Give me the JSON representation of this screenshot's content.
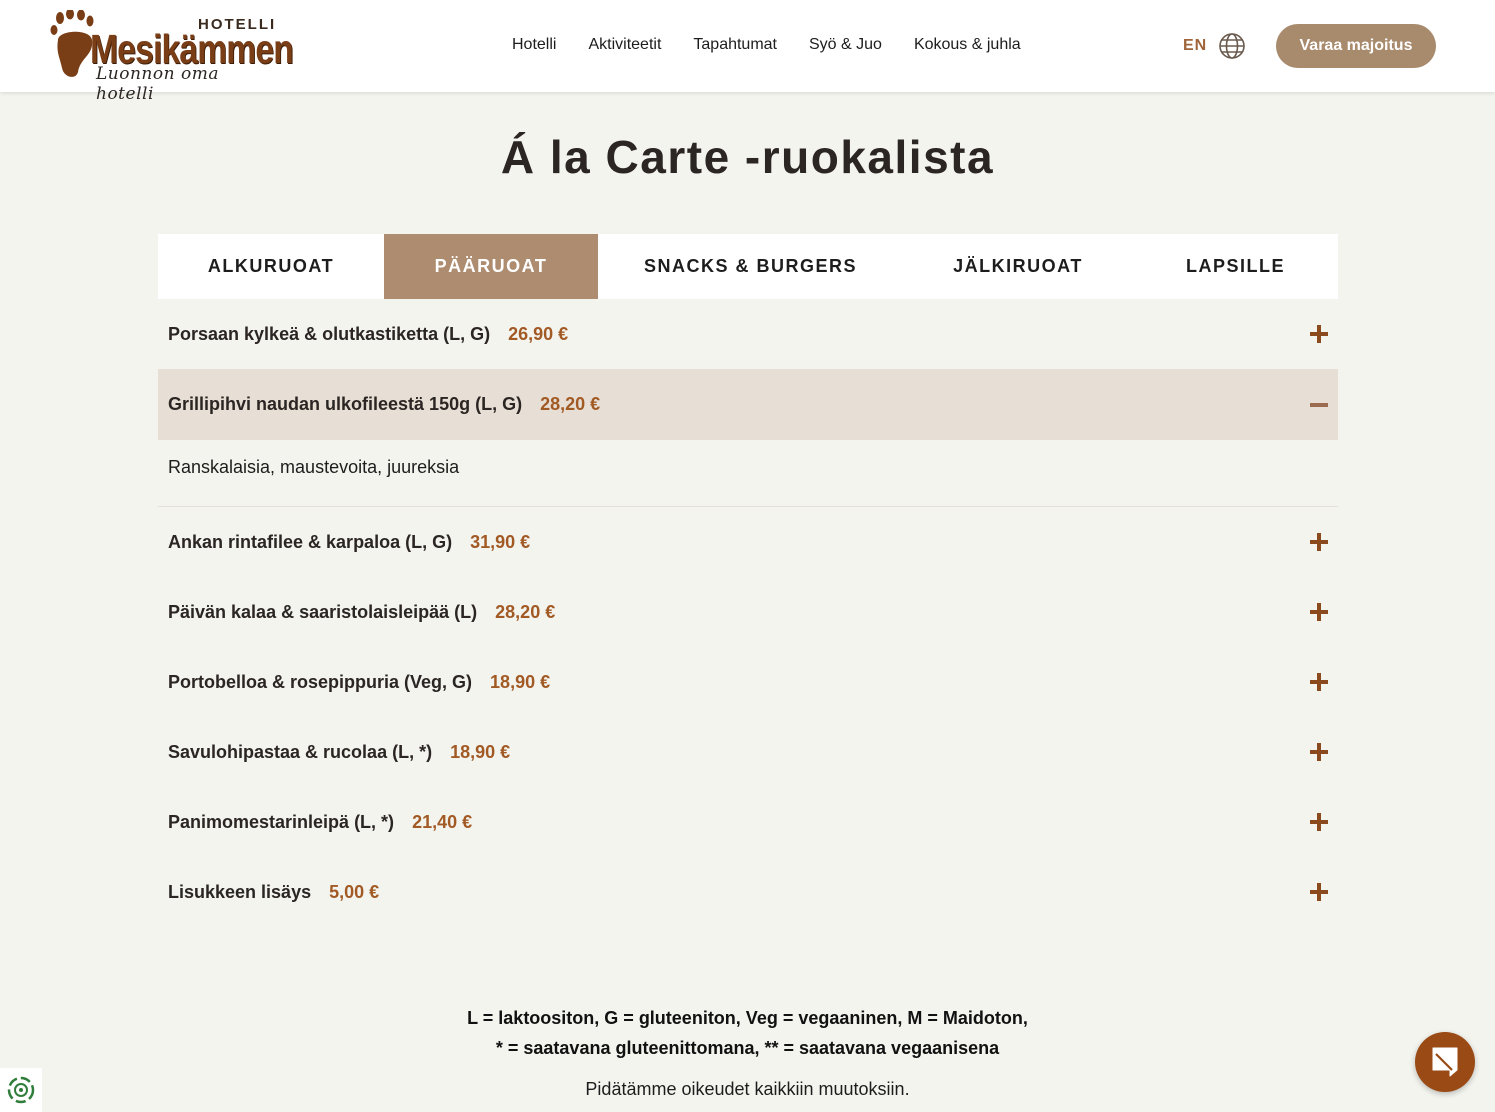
{
  "header": {
    "logo": {
      "hotelli": "HOTELLI",
      "name": "Mesikämmen",
      "tagline": "Luonnon oma hotelli"
    },
    "nav": [
      "Hotelli",
      "Aktiviteetit",
      "Tapahtumat",
      "Syö & Juo",
      "Kokous & juhla"
    ],
    "lang": "EN",
    "book_label": "Varaa majoitus"
  },
  "title": "Á la Carte -ruokalista",
  "tabs": [
    {
      "label": "ALKURUOAT",
      "active": false
    },
    {
      "label": "PÄÄRUOAT",
      "active": true
    },
    {
      "label": "SNACKS & BURGERS",
      "active": false
    },
    {
      "label": "JÄLKIRUOAT",
      "active": false
    },
    {
      "label": "LAPSILLE",
      "active": false
    }
  ],
  "items": [
    {
      "name": "Porsaan kylkeä & olutkastiketta (L, G)",
      "price": "26,90 €",
      "open": false
    },
    {
      "name": "Grillipihvi naudan ulkofileestä 150g (L, G)",
      "price": "28,20 €",
      "open": true,
      "description": "Ranskalaisia, maustevoita, juureksia"
    },
    {
      "name": "Ankan rintafilee & karpaloa (L, G)",
      "price": "31,90 €",
      "open": false
    },
    {
      "name": "Päivän kalaa & saaristolaisleipää (L)",
      "price": "28,20 €",
      "open": false
    },
    {
      "name": "Portobelloa & rosepippuria (Veg, G)",
      "price": "18,90 €",
      "open": false
    },
    {
      "name": "Savulohipastaa & rucolaa (L, *)",
      "price": "18,90 €",
      "open": false
    },
    {
      "name": "Panimomestarinleipä (L, *)",
      "price": "21,40 €",
      "open": false
    },
    {
      "name": "Lisukkeen lisäys",
      "price": "5,00 €",
      "open": false
    }
  ],
  "legend": {
    "line1": "L = laktoositon, G = gluteeniton, Veg = vegaaninen, M = Maidoton,",
    "line2": "* = saatavana gluteenittomana, ** = saatavana vegaanisena"
  },
  "disclaimer": "Pidätämme oikeudet kaikkiin muutoksiin.",
  "colors": {
    "accent": "#ad8c6f",
    "price": "#a25a25",
    "background": "#f4f4ef",
    "chat": "#9a4a15"
  }
}
